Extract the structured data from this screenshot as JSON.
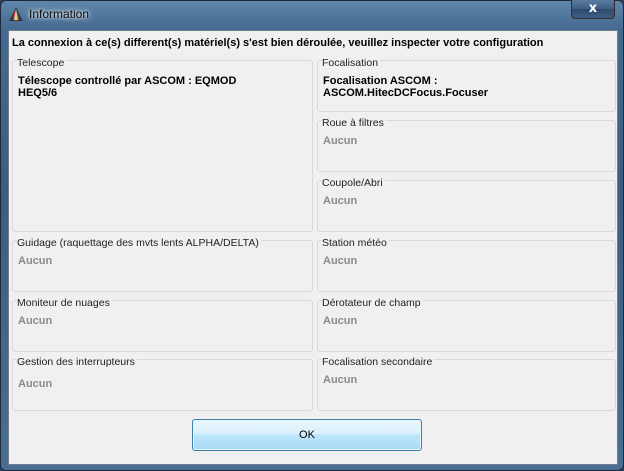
{
  "window": {
    "title": "Information",
    "close_label": "x"
  },
  "headline": "La connexion à ce(s) different(s) matériel(s) s'est bien déroulée, veuillez inspecter votre configuration",
  "groups": {
    "telescope": {
      "label": "Telescope",
      "value": "Télescope controllé par ASCOM : EQMOD HEQ5/6"
    },
    "focalisation": {
      "label": "Focalisation",
      "value": "Focalisation ASCOM : ASCOM.HitecDCFocus.Focuser"
    },
    "roue": {
      "label": "Roue à filtres",
      "value": "Aucun"
    },
    "coupole": {
      "label": "Coupole/Abri",
      "value": "Aucun"
    },
    "guidage": {
      "label": "Guidage (raquettage des mvts lents ALPHA/DELTA)",
      "value": "Aucun"
    },
    "station": {
      "label": "Station météo",
      "value": "Aucun"
    },
    "nuages": {
      "label": "Moniteur de nuages",
      "value": "Aucun"
    },
    "derotateur": {
      "label": "Dérotateur de champ",
      "value": "Aucun"
    },
    "interrupteurs": {
      "label": "Gestion des interrupteurs",
      "value": "Aucun"
    },
    "focalisation2": {
      "label": "Focalisation secondaire",
      "value": "Aucun"
    }
  },
  "ok_label": "OK"
}
